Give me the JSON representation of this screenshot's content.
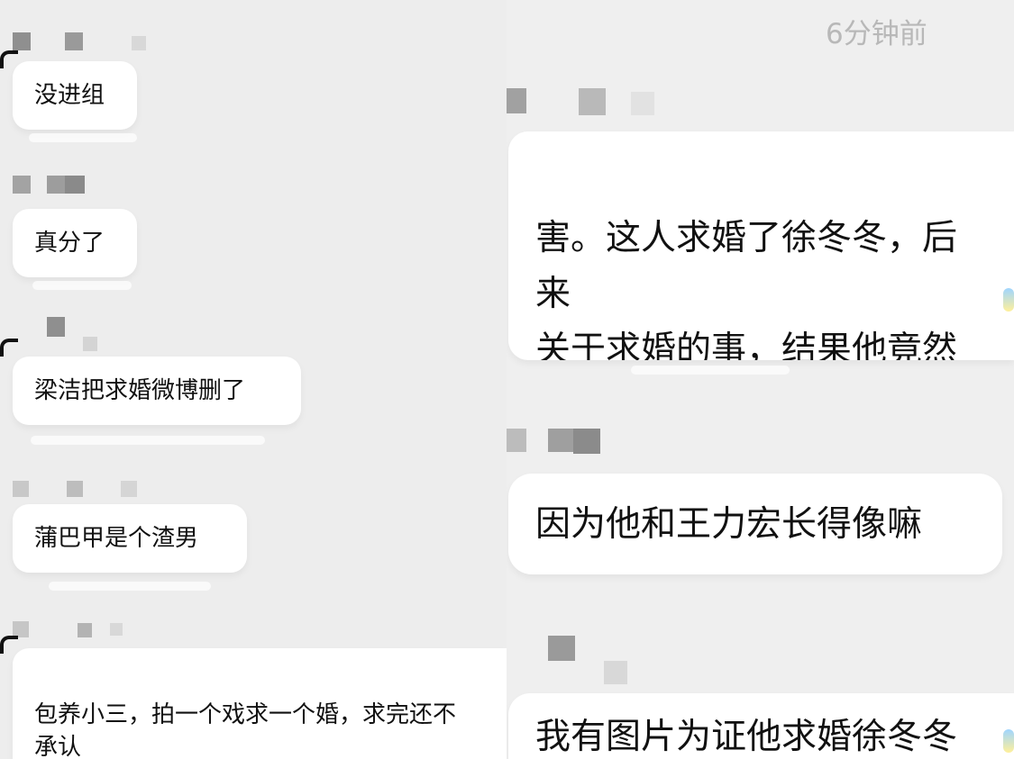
{
  "left_panel": {
    "messages": [
      {
        "text": "没进组"
      },
      {
        "text": "真分了"
      },
      {
        "text": "梁洁把求婚微博删了"
      },
      {
        "text": "蒲巴甲是个渣男"
      },
      {
        "text": "包养小三，拍一个戏求一个婚，求完还不\n承认"
      }
    ]
  },
  "right_panel": {
    "timestamp": "6分钟前",
    "messages": [
      {
        "text": "害。这人求婚了徐冬冬，后来\n关于求婚的事，结果他竟然说\n可能是王力宏求的婚？？？"
      },
      {
        "text": "因为他和王力宏长得像嘛"
      },
      {
        "text": "我有图片为证他求婚徐冬冬"
      }
    ]
  }
}
